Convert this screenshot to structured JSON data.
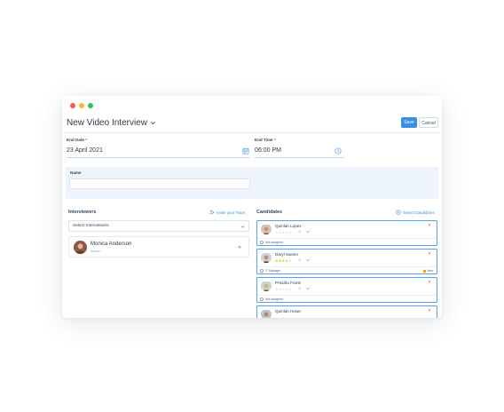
{
  "window": {
    "title": "New Video Interview",
    "save_label": "Save",
    "cancel_label": "Cancel"
  },
  "fields": {
    "end_date": {
      "label": "End Date",
      "required_mark": "*",
      "value": "23 April 2021"
    },
    "end_time": {
      "label": "End Time",
      "required_mark": "*",
      "value": "06:00 PM"
    },
    "name": {
      "label": "Name",
      "value": ""
    }
  },
  "interviewers": {
    "title": "Interviewers",
    "invite_link": "Invite your Team",
    "select_placeholder": "Select Interviewers",
    "people": [
      {
        "name": "Monica Anderson",
        "role": "Admin"
      }
    ]
  },
  "candidates": {
    "title": "Candidates",
    "select_link": "Select Candidates",
    "items": [
      {
        "name": "Quinlan Lopez",
        "rating": 0,
        "comments": "0",
        "attachments": "4",
        "status": "Not Assigned",
        "badge": "",
        "stars": "★★★★★"
      },
      {
        "name": "Daryl Sween",
        "rating": 4,
        "comments": "0",
        "attachments": "4",
        "status": "IT Manager",
        "badge": "New",
        "stars": "★★★★★"
      },
      {
        "name": "Priscilla Frank",
        "rating": 0,
        "comments": "0",
        "attachments": "4",
        "status": "Not Assigned",
        "badge": "",
        "stars": "★★★★★"
      },
      {
        "name": "Quinlan Howe",
        "rating": 0,
        "comments": "",
        "attachments": "",
        "status": "",
        "badge": "",
        "stars": ""
      }
    ]
  },
  "colors": {
    "accent": "#3b8fe0",
    "danger": "#e64a4a",
    "star_filled": "#f4b400",
    "star_empty": "#d9dee4",
    "badge": "#f39c12"
  }
}
